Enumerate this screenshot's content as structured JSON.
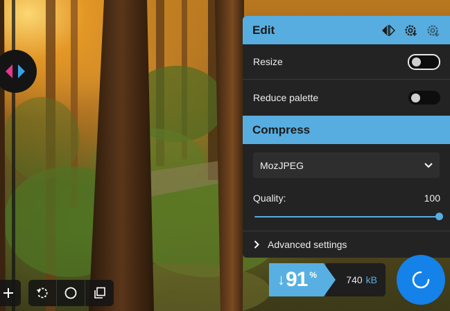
{
  "options_panel": {
    "edit_section": {
      "title": "Edit",
      "resize": {
        "label": "Resize",
        "enabled": false
      },
      "reduce_palette": {
        "label": "Reduce palette",
        "enabled": false
      }
    },
    "compress_section": {
      "title": "Compress",
      "codec": {
        "selected": "MozJPEG"
      },
      "quality": {
        "label": "Quality:",
        "value": "100"
      },
      "advanced_settings": {
        "label": "Advanced settings"
      }
    }
  },
  "results": {
    "reduction_arrow": "↓",
    "reduction_value": "91",
    "reduction_unit": "%",
    "size_value": "740",
    "size_unit": "kB"
  },
  "colors": {
    "accent": "#57ade0",
    "panel": "#232323",
    "fab": "#1482e8",
    "split_left_arrow": "#e8358f",
    "split_right_arrow": "#3aa0e8"
  },
  "icons": [
    "split-view-icon",
    "settings-save-icon",
    "settings-import-icon",
    "chevron-down-icon",
    "chevron-right-icon",
    "plus-icon",
    "rotate-icon",
    "circle-icon",
    "crop-icon",
    "loading-spinner-icon"
  ]
}
